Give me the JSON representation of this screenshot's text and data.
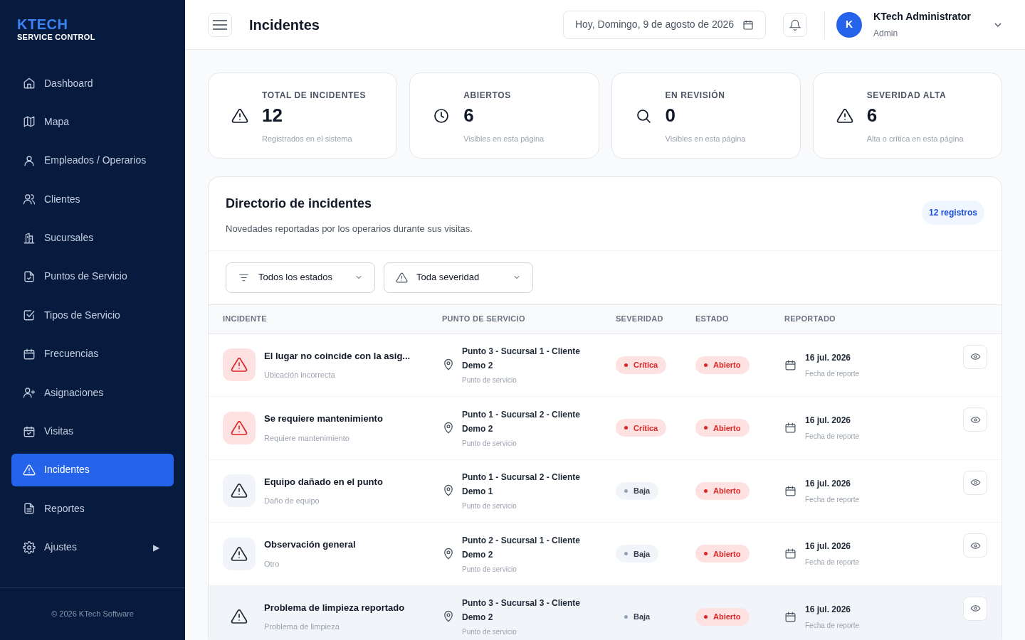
{
  "brand": {
    "name": "KTECH",
    "subtitle": "SERVICE CONTROL"
  },
  "sidebar": {
    "items": [
      {
        "label": "Dashboard",
        "selected": false
      },
      {
        "label": "Mapa",
        "selected": false
      },
      {
        "label": "Empleados / Operarios",
        "selected": false
      },
      {
        "label": "Clientes",
        "selected": false
      },
      {
        "label": "Sucursales",
        "selected": false
      },
      {
        "label": "Puntos de Servicio",
        "selected": false
      },
      {
        "label": "Tipos de Servicio",
        "selected": false
      },
      {
        "label": "Frecuencias",
        "selected": false
      },
      {
        "label": "Asignaciones",
        "selected": false
      },
      {
        "label": "Visitas",
        "selected": false
      },
      {
        "label": "Incidentes",
        "selected": true
      },
      {
        "label": "Reportes",
        "selected": false
      },
      {
        "label": "Ajustes",
        "selected": false,
        "arrow": "▶"
      }
    ],
    "footer": "© 2026 KTech Software"
  },
  "header": {
    "title": "Incidentes",
    "date": "Hoy, Domingo, 9 de agosto de 2026",
    "user": {
      "initial": "K",
      "name": "KTech Administrator",
      "role": "Admin"
    }
  },
  "stats": [
    {
      "label": "TOTAL DE INCIDENTES",
      "value": "12",
      "note": "Registrados en el sistema"
    },
    {
      "label": "ABIERTOS",
      "value": "6",
      "note": "Visibles en esta página"
    },
    {
      "label": "EN REVISIÓN",
      "value": "0",
      "note": "Visibles en esta página"
    },
    {
      "label": "SEVERIDAD ALTA",
      "value": "6",
      "note": "Alta o crítica en esta página"
    }
  ],
  "directory": {
    "title": "Directorio de incidentes",
    "subtitle": "Novedades reportadas por los operarios durante sus visitas.",
    "count": "12 registros",
    "filters": [
      {
        "value": "Todos los estados"
      },
      {
        "value": "Toda severidad"
      }
    ],
    "table": {
      "columns": [
        "INCIDENTE",
        "PUNTO DE SERVICIO",
        "SEVERIDAD",
        "ESTADO",
        "REPORTADO"
      ],
      "rows": [
        {
          "title": "El lugar no coincide con la asig...",
          "type": "Ubicación incorrecta",
          "point": "Punto 3 - Sucursal 1 - Cliente Demo 2",
          "point_note": "Punto de servicio",
          "severity": {
            "label": "Crítica",
            "kind": "high"
          },
          "status": "Abierto",
          "date": "16 jul. 2026",
          "date_note": "Fecha de reporte",
          "hovered": false
        },
        {
          "title": "Se requiere mantenimiento",
          "type": "Requiere mantenimiento",
          "point": "Punto 1 - Sucursal 2 - Cliente Demo 2",
          "point_note": "Punto de servicio",
          "severity": {
            "label": "Crítica",
            "kind": "high"
          },
          "status": "Abierto",
          "date": "16 jul. 2026",
          "date_note": "Fecha de reporte",
          "hovered": false
        },
        {
          "title": "Equipo dañado en el punto",
          "type": "Daño de equipo",
          "point": "Punto 1 - Sucursal 2 - Cliente Demo 1",
          "point_note": "Punto de servicio",
          "severity": {
            "label": "Baja",
            "kind": "low"
          },
          "status": "Abierto",
          "date": "16 jul. 2026",
          "date_note": "Fecha de reporte",
          "hovered": false
        },
        {
          "title": "Observación general",
          "type": "Otro",
          "point": "Punto 2 - Sucursal 1 - Cliente Demo 2",
          "point_note": "Punto de servicio",
          "severity": {
            "label": "Baja",
            "kind": "low"
          },
          "status": "Abierto",
          "date": "16 jul. 2026",
          "date_note": "Fecha de reporte",
          "hovered": false
        },
        {
          "title": "Problema de limpieza reportado",
          "type": "Problema de limpieza",
          "point": "Punto 3 - Sucursal 3 - Cliente Demo 2",
          "point_note": "Punto de servicio",
          "severity": {
            "label": "Baja",
            "kind": "low"
          },
          "status": "Abierto",
          "date": "16 jul. 2026",
          "date_note": "Fecha de reporte",
          "hovered": true
        }
      ]
    }
  }
}
